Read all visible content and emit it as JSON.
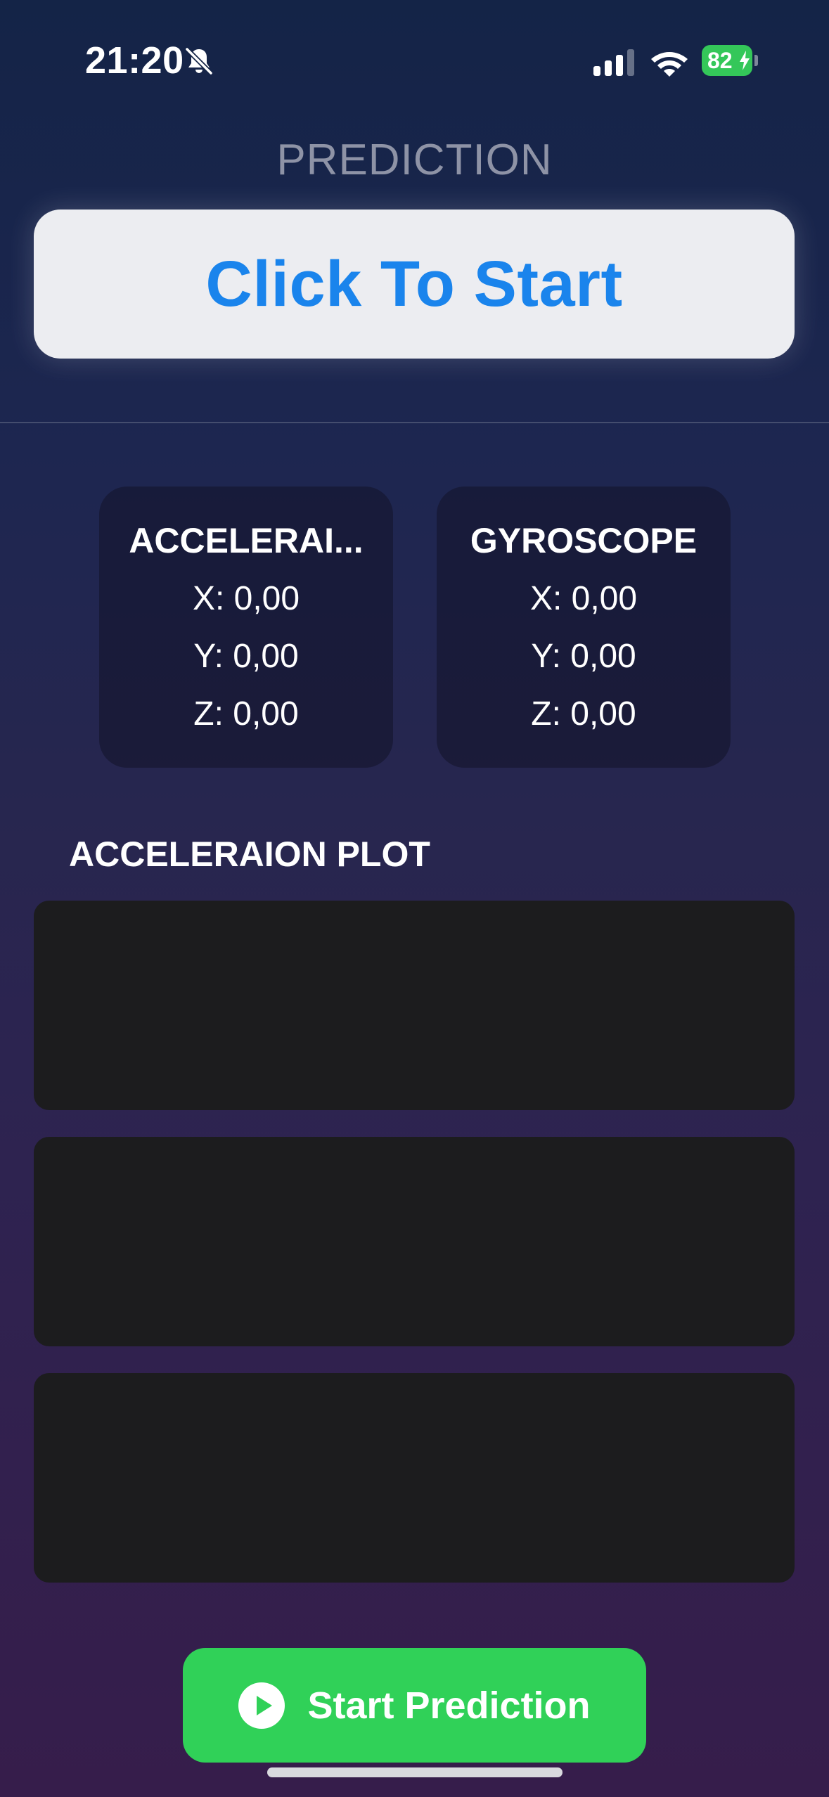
{
  "status_bar": {
    "time": "21:20",
    "battery_level": "82",
    "battery_color": "#34c759",
    "icons": [
      "bell-slash-icon",
      "cellular-signal-icon",
      "wifi-icon",
      "battery-charging-icon"
    ]
  },
  "header": {
    "title": "PREDICTION",
    "start_card_label": "Click To Start",
    "start_card_label_color": "#1a84ec"
  },
  "sensors": {
    "accelerometer": {
      "title": "ACCELERAI...",
      "x": "X: 0,00",
      "y": "Y: 0,00",
      "z": "Z: 0,00"
    },
    "gyroscope": {
      "title": "GYROSCOPE",
      "x": "X: 0,00",
      "y": "Y: 0,00",
      "z": "Z: 0,00"
    }
  },
  "plot": {
    "heading": "ACCELERAION PLOT",
    "panels": 3
  },
  "actions": {
    "start_prediction_label": "Start Prediction",
    "start_prediction_icon": "play-circle-icon",
    "accent_color": "#30d158"
  }
}
